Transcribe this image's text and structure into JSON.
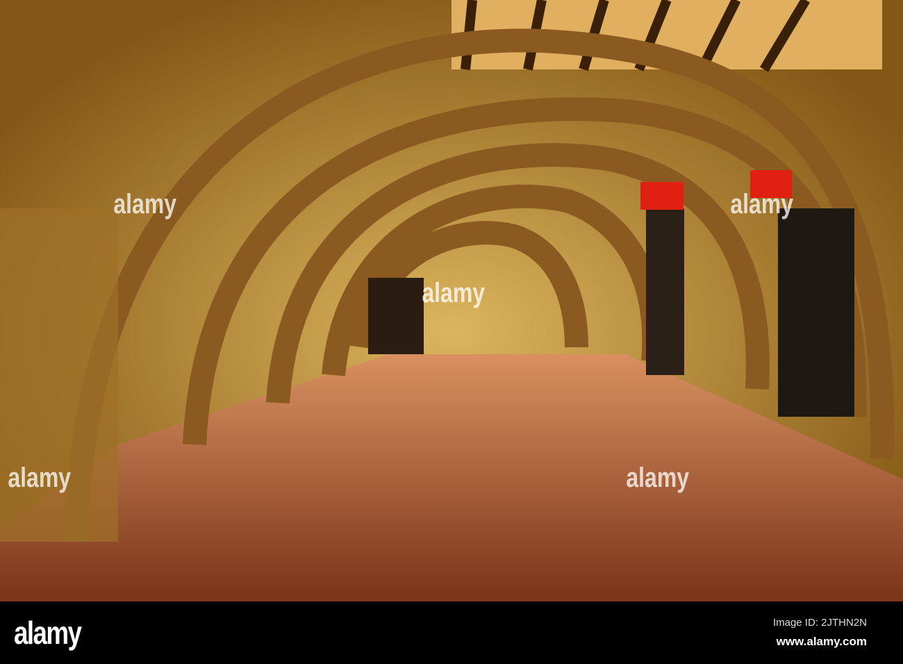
{
  "photo": {
    "subject": "stone-arcade-at-night",
    "colors": {
      "stone": "#c8a050",
      "floor": "#b8603a",
      "wall": "#d4a030",
      "shutter_red": "#e02010"
    }
  },
  "watermark": {
    "text": "alamy"
  },
  "footer": {
    "logo": "alamy",
    "image_id": "Image ID: 2JTHN2N",
    "url": "www.alamy.com"
  }
}
